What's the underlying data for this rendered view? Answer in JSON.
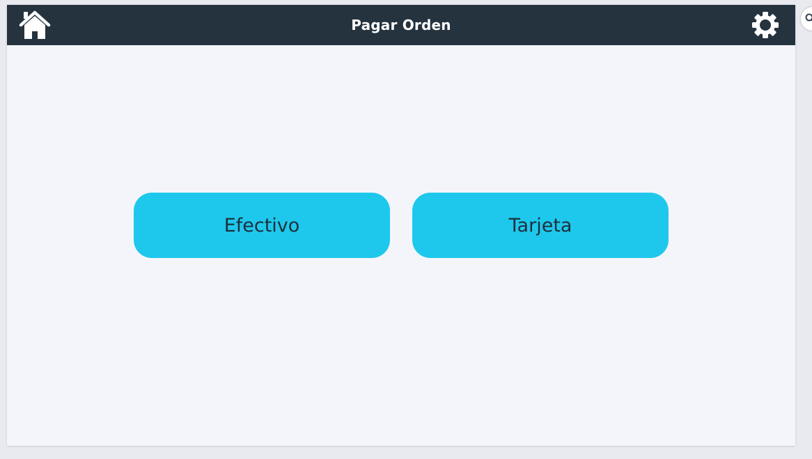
{
  "header": {
    "title": "Pagar Orden",
    "home_icon": "home-icon",
    "settings_icon": "gear-icon",
    "background": "#25333f"
  },
  "payment": {
    "options": [
      {
        "label": "Efectivo"
      },
      {
        "label": "Tarjeta"
      }
    ],
    "button_color": "#1ec8ed",
    "text_color": "#1e2f3b"
  },
  "edge_widget": {
    "icon": "search-icon"
  },
  "colors": {
    "page_background": "#f4f5fa"
  }
}
